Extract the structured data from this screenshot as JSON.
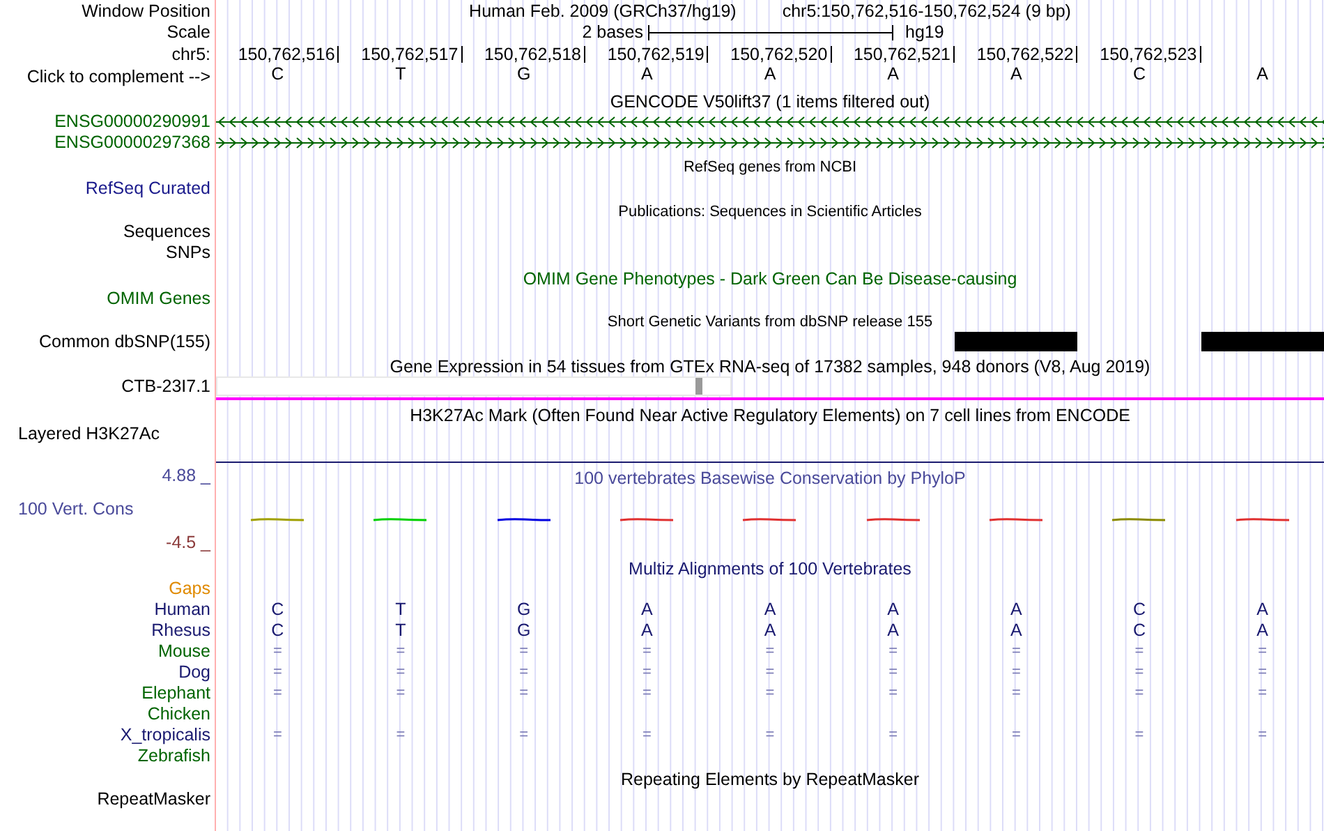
{
  "header": {
    "label": "Window Position",
    "assembly": "Human Feb. 2009 (GRCh37/hg19)",
    "position": "chr5:150,762,516-150,762,524 (9 bp)"
  },
  "scale": {
    "label": "Scale",
    "span": "2 bases",
    "db": "hg19"
  },
  "ruler": {
    "label": "chr5:",
    "positions": [
      "150,762,516",
      "150,762,517",
      "150,762,518",
      "150,762,519",
      "150,762,520",
      "150,762,521",
      "150,762,522",
      "150,762,523"
    ]
  },
  "complement": {
    "label": "Click to complement -->",
    "bases": [
      "C",
      "T",
      "G",
      "A",
      "A",
      "A",
      "A",
      "C",
      "A"
    ]
  },
  "tracks": [
    {
      "kind": "title",
      "title": {
        "text": "GENCODE V50lift37 (1 items filtered out)",
        "color": "#000000"
      }
    },
    {
      "kind": "gene_reverse",
      "label": {
        "text": "ENSG00000290991",
        "color": "#006400"
      }
    },
    {
      "kind": "gene_forward",
      "label": {
        "text": "ENSG00000297368",
        "color": "#006400"
      }
    },
    {
      "kind": "small_title",
      "title": {
        "text": "RefSeq genes from NCBI",
        "color": "#000000"
      }
    },
    {
      "kind": "label",
      "label": {
        "text": "RefSeq Curated",
        "color": "#1a1a8c"
      }
    },
    {
      "kind": "small_title",
      "title": {
        "text": "Publications: Sequences in Scientific Articles",
        "color": "#000000"
      }
    },
    {
      "kind": "label",
      "label": {
        "text": "Sequences",
        "color": "#000000"
      }
    },
    {
      "kind": "label",
      "label": {
        "text": "SNPs",
        "color": "#000000"
      }
    },
    {
      "kind": "title",
      "title": {
        "text": "OMIM Gene Phenotypes - Dark Green Can Be Disease-causing",
        "color": "#006400"
      }
    },
    {
      "kind": "label",
      "label": {
        "text": "OMIM Genes",
        "color": "#006400"
      }
    },
    {
      "kind": "small_title",
      "title": {
        "text": "Short Genetic Variants from dbSNP release 155",
        "color": "#000000"
      }
    },
    {
      "kind": "snp",
      "label": {
        "text": "Common dbSNP(155)",
        "color": "#000000"
      },
      "variants": [
        false,
        false,
        false,
        false,
        false,
        false,
        true,
        false,
        true
      ]
    },
    {
      "kind": "title",
      "title": {
        "text": "Gene Expression in 54 tissues from GTEx RNA-seq of 17382 samples, 948 donors (V8, Aug 2019)",
        "color": "#000000"
      }
    },
    {
      "kind": "expression",
      "label": {
        "text": "CTB-23I7.1",
        "color": "#000000"
      }
    },
    {
      "kind": "divider",
      "color": "#ff00ff"
    },
    {
      "kind": "title",
      "title": {
        "text": "H3K27Ac Mark (Often Found Near Active Regulatory Elements) on 7 cell lines from ENCODE",
        "color": "#000000"
      }
    },
    {
      "kind": "layered",
      "label": {
        "text": "Layered H3K27Ac",
        "color": "#000000"
      }
    },
    {
      "kind": "divider",
      "color": "#1a1a6e"
    },
    {
      "kind": "title",
      "label": {
        "text": "4.88 _",
        "color": "#4a4a9a"
      },
      "title": {
        "text": "100 vertebrates Basewise Conservation by PhyloP",
        "color": "#4a4a9a"
      }
    },
    {
      "kind": "wiggle",
      "label": {
        "text": "100 Vert. Cons",
        "color": "#4a4a9a"
      }
    },
    {
      "kind": "label",
      "label": {
        "text": "-4.5 _",
        "color": "#8b3a3a"
      }
    },
    {
      "kind": "title",
      "title": {
        "text": "Multiz Alignments of 100 Vertebrates",
        "color": "#1a1a70"
      }
    },
    {
      "kind": "label",
      "label": {
        "text": "Gaps",
        "color": "#e08a00"
      }
    },
    {
      "kind": "bases",
      "label": {
        "text": "Human",
        "color": "#1a1a70"
      },
      "cells": [
        "C",
        "T",
        "G",
        "A",
        "A",
        "A",
        "A",
        "C",
        "A"
      ]
    },
    {
      "kind": "bases",
      "label": {
        "text": "Rhesus",
        "color": "#1a1a70"
      },
      "cells": [
        "C",
        "T",
        "G",
        "A",
        "A",
        "A",
        "A",
        "C",
        "A"
      ]
    },
    {
      "kind": "matches",
      "label": {
        "text": "Mouse",
        "color": "#006400"
      },
      "cells": [
        "=",
        "=",
        "=",
        "=",
        "=",
        "=",
        "=",
        "=",
        "="
      ]
    },
    {
      "kind": "matches",
      "label": {
        "text": "Dog",
        "color": "#1a1a70"
      },
      "cells": [
        "=",
        "=",
        "=",
        "=",
        "=",
        "=",
        "=",
        "=",
        "="
      ]
    },
    {
      "kind": "matches",
      "label": {
        "text": "Elephant",
        "color": "#006400"
      },
      "cells": [
        "=",
        "=",
        "=",
        "=",
        "=",
        "=",
        "=",
        "=",
        "="
      ]
    },
    {
      "kind": "label",
      "label": {
        "text": "Chicken",
        "color": "#006400"
      }
    },
    {
      "kind": "matches",
      "label": {
        "text": "X_tropicalis",
        "color": "#1a1a70"
      },
      "cells": [
        "=",
        "=",
        "=",
        "=",
        "=",
        "=",
        "=",
        "=",
        "="
      ]
    },
    {
      "kind": "label",
      "label": {
        "text": "Zebrafish",
        "color": "#006400"
      }
    },
    {
      "kind": "title",
      "title": {
        "text": "Repeating Elements by RepeatMasker",
        "color": "#000000"
      }
    },
    {
      "kind": "label",
      "label": {
        "text": "RepeatMasker",
        "color": "#000000"
      }
    }
  ]
}
